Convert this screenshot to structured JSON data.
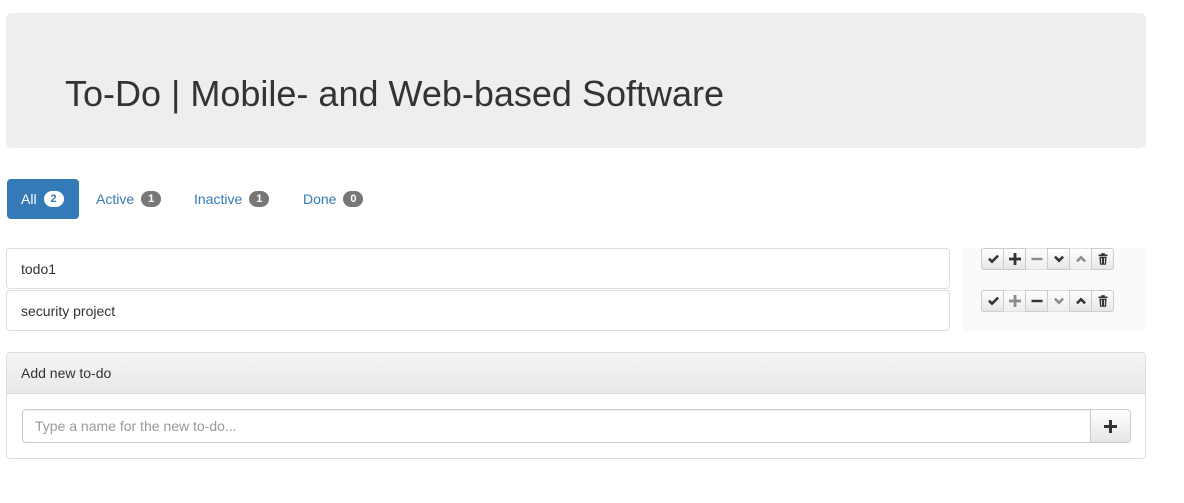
{
  "header": {
    "title": "To-Do | Mobile- and Web-based Software"
  },
  "tabs": [
    {
      "label": "All",
      "count": "2",
      "active": true
    },
    {
      "label": "Active",
      "count": "1",
      "active": false
    },
    {
      "label": "Inactive",
      "count": "1",
      "active": false
    },
    {
      "label": "Done",
      "count": "0",
      "active": false
    }
  ],
  "todos": [
    {
      "name": "todo1",
      "actions": [
        {
          "icon": "check-icon",
          "enabled": true
        },
        {
          "icon": "plus-icon",
          "enabled": true
        },
        {
          "icon": "minus-icon",
          "enabled": false
        },
        {
          "icon": "chevron-down-icon",
          "enabled": true
        },
        {
          "icon": "chevron-up-icon",
          "enabled": false
        },
        {
          "icon": "trash-icon",
          "enabled": true
        }
      ]
    },
    {
      "name": "security project",
      "actions": [
        {
          "icon": "check-icon",
          "enabled": true
        },
        {
          "icon": "plus-icon",
          "enabled": false
        },
        {
          "icon": "minus-icon",
          "enabled": true
        },
        {
          "icon": "chevron-down-icon",
          "enabled": false
        },
        {
          "icon": "chevron-up-icon",
          "enabled": true
        },
        {
          "icon": "trash-icon",
          "enabled": true
        }
      ]
    }
  ],
  "new_todo": {
    "heading": "Add new to-do",
    "placeholder": "Type a name for the new to-do...",
    "value": "",
    "add_icon": "plus-icon"
  },
  "colors": {
    "primary": "#337ab7",
    "badge": "#777777",
    "jumbotron": "#eeeeee"
  }
}
